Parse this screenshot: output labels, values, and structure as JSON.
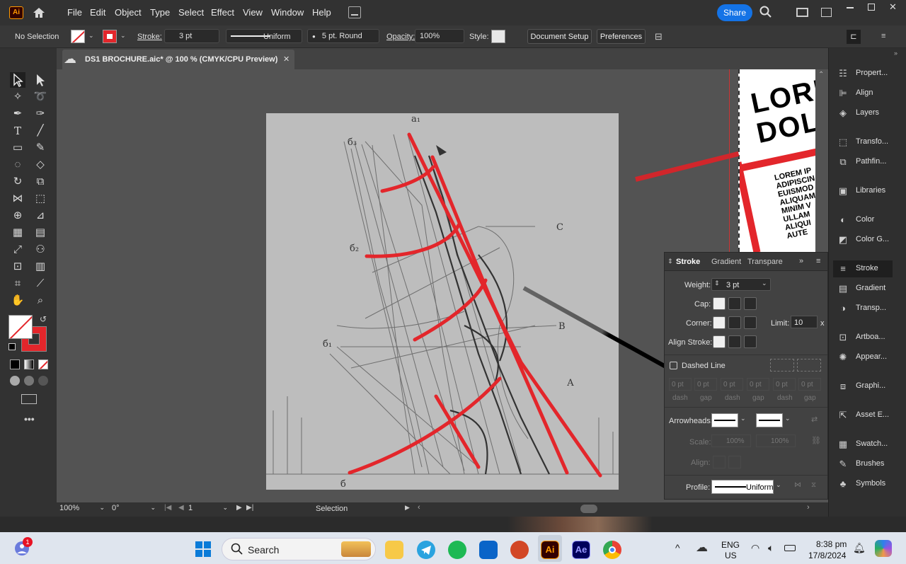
{
  "app": {
    "logo": "Ai",
    "share_label": "Share"
  },
  "menu": [
    "File",
    "Edit",
    "Object",
    "Type",
    "Select",
    "Effect",
    "View",
    "Window",
    "Help"
  ],
  "control_bar": {
    "selection": "No Selection",
    "stroke_label": "Stroke:",
    "stroke_weight": "3 pt",
    "profile": "Uniform",
    "brush": "5 pt. Round",
    "opacity_label": "Opacity:",
    "opacity_value": "100%",
    "style_label": "Style:",
    "document_setup": "Document Setup",
    "preferences": "Preferences"
  },
  "document": {
    "tab_title": "DS1 BROCHURE.aic* @ 100 % (CMYK/CPU Preview)"
  },
  "status_bar": {
    "zoom": "100%",
    "rotation": "0°",
    "artboard": "1",
    "tool": "Selection"
  },
  "artboard_text": {
    "line1": "LORE",
    "line2": "DOL",
    "body": [
      "LOREM IP",
      "ADIPISCIN",
      "EUISMOD",
      "ALIQUAM",
      "MINIM V",
      "ULLAM",
      "ALIQUI",
      "AUTE"
    ]
  },
  "right_dock": [
    {
      "label": "Propert...",
      "icon": "properties-icon"
    },
    {
      "label": "Align",
      "icon": "align-icon"
    },
    {
      "label": "Layers",
      "icon": "layers-icon"
    },
    {
      "label": "Transfo...",
      "icon": "transform-icon"
    },
    {
      "label": "Pathfin...",
      "icon": "pathfinder-icon"
    },
    {
      "label": "Libraries",
      "icon": "libraries-icon"
    },
    {
      "label": "Color",
      "icon": "color-icon"
    },
    {
      "label": "Color G...",
      "icon": "color-guide-icon"
    },
    {
      "label": "Stroke",
      "icon": "stroke-icon"
    },
    {
      "label": "Gradient",
      "icon": "gradient-icon"
    },
    {
      "label": "Transp...",
      "icon": "transparency-icon"
    },
    {
      "label": "Artboa...",
      "icon": "artboards-icon"
    },
    {
      "label": "Appear...",
      "icon": "appearance-icon"
    },
    {
      "label": "Graphi...",
      "icon": "graphic-styles-icon"
    },
    {
      "label": "Asset E...",
      "icon": "asset-export-icon"
    },
    {
      "label": "Swatch...",
      "icon": "swatches-icon"
    },
    {
      "label": "Brushes",
      "icon": "brushes-icon"
    },
    {
      "label": "Symbols",
      "icon": "symbols-icon"
    }
  ],
  "stroke_panel": {
    "tabs": [
      "Stroke",
      "Gradient",
      "Transparen"
    ],
    "weight_label": "Weight:",
    "weight_value": "3 pt",
    "cap_label": "Cap:",
    "corner_label": "Corner:",
    "limit_label": "Limit:",
    "limit_value": "10",
    "limit_unit": "x",
    "align_label": "Align Stroke:",
    "dashed_label": "Dashed Line",
    "dash_values": [
      "0 pt",
      "0 pt",
      "0 pt",
      "0 pt",
      "0 pt",
      "0 pt"
    ],
    "dash_labels": [
      "dash",
      "gap",
      "dash",
      "gap",
      "dash",
      "gap"
    ],
    "arrowheads_label": "Arrowheads:",
    "scale_label": "Scale:",
    "scale_values": [
      "100%",
      "100%"
    ],
    "align_arrow_label": "Align:",
    "profile_label": "Profile:",
    "profile_value": "Uniform"
  },
  "taskbar": {
    "search_label": "Search",
    "lang_line1": "ENG",
    "lang_line2": "US",
    "time": "8:38 pm",
    "date": "17/8/2024",
    "notification_count": "1",
    "apps": [
      {
        "name": "start-icon"
      },
      {
        "name": "file-explorer-icon"
      },
      {
        "name": "telegram-icon"
      },
      {
        "name": "spotify-icon"
      },
      {
        "name": "outlook-icon"
      },
      {
        "name": "powerpoint-icon"
      },
      {
        "name": "illustrator-icon",
        "label": "Ai"
      },
      {
        "name": "after-effects-icon",
        "label": "Ae"
      },
      {
        "name": "chrome-icon"
      }
    ]
  },
  "colors": {
    "accent": "#1473e6",
    "stroke_red": "#e3262b",
    "ai_orange": "#ff9a00",
    "ai_bg": "#330000"
  }
}
